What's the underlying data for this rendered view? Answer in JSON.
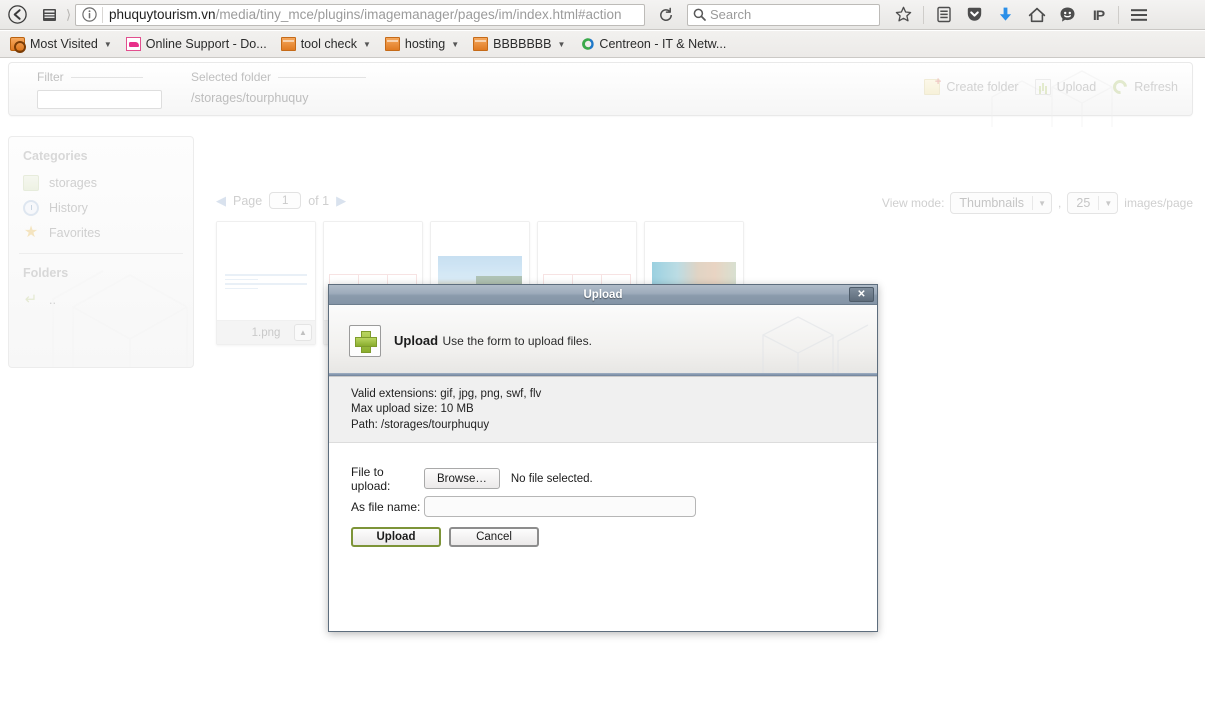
{
  "browser": {
    "url_host": "phuquytourism.vn",
    "url_path": "/media/tiny_mce/plugins/imagemanager/pages/im/index.html#action",
    "search_placeholder": "Search",
    "back_icon": "back-arrow-icon",
    "identity_icon": "info-circle-icon",
    "reload_icon": "reload-icon",
    "search_icon": "search-icon",
    "toolbar_icons": [
      {
        "name": "bookmark-star-icon",
        "glyph": "star"
      },
      {
        "name": "reading-list-icon",
        "glyph": "list"
      },
      {
        "name": "pocket-icon",
        "glyph": "shield"
      },
      {
        "name": "downloads-icon",
        "glyph": "down-arrow"
      },
      {
        "name": "home-icon",
        "glyph": "home"
      },
      {
        "name": "feedback-smiley-icon",
        "glyph": "smiley"
      },
      {
        "name": "ip-indicator-icon",
        "glyph": "IP"
      },
      {
        "name": "menu-hamburger-icon",
        "glyph": "hamburger"
      }
    ],
    "bookmarks": [
      {
        "label": "Most Visited",
        "icon": "most-visited-icon",
        "has_arrow": true
      },
      {
        "label": "Online Support - Do...",
        "icon": "support-icon",
        "has_arrow": false
      },
      {
        "label": "tool check",
        "icon": "folder-icon",
        "has_arrow": true
      },
      {
        "label": "hosting",
        "icon": "folder-icon",
        "has_arrow": true
      },
      {
        "label": "BBBBBBB",
        "icon": "folder-icon",
        "has_arrow": true
      },
      {
        "label": "Centreon - IT & Netw...",
        "icon": "centreon-icon",
        "has_arrow": false
      }
    ]
  },
  "top_panel": {
    "filter_legend": "Filter",
    "filter_value": "",
    "folder_legend": "Selected folder",
    "folder_value": "/storages/tourphuquy",
    "actions": [
      {
        "label": "Create folder",
        "icon": "new-folder-icon"
      },
      {
        "label": "Upload",
        "icon": "upload-icon"
      },
      {
        "label": "Refresh",
        "icon": "refresh-icon"
      }
    ]
  },
  "sidebar": {
    "categories_title": "Categories",
    "categories": [
      {
        "label": "storages",
        "icon": "drive-icon"
      },
      {
        "label": "History",
        "icon": "clock-icon"
      },
      {
        "label": "Favorites",
        "icon": "star-icon"
      }
    ],
    "folders_title": "Folders",
    "folders": [
      {
        "label": "..",
        "icon": "folder-up-icon"
      }
    ]
  },
  "pager": {
    "prev_icon": "prev-page-icon",
    "page_label": "Page",
    "page_value": "1",
    "of_label": "of 1",
    "next_icon": "next-page-icon"
  },
  "viewmode": {
    "label": "View mode:",
    "mode_value": "Thumbnails",
    "comma": ",",
    "count_value": "25",
    "suffix": "images/page"
  },
  "thumbnails": [
    {
      "caption": "1.png",
      "kind": "document-lines"
    },
    {
      "caption": "",
      "kind": "document-table"
    },
    {
      "caption": "",
      "kind": "photo-beach"
    },
    {
      "caption": "",
      "kind": "document-table"
    },
    {
      "caption": "",
      "kind": "photo-coral"
    }
  ],
  "dialog": {
    "title": "Upload",
    "close_icon": "close-icon",
    "header_icon": "green-plus-icon",
    "header_title": "Upload",
    "header_subtitle": "Use the form to upload files.",
    "info": {
      "extensions": "Valid extensions: gif, jpg, png, swf, flv",
      "max_size": "Max upload size: 10 MB",
      "path": "Path: /storages/tourphuquy"
    },
    "form": {
      "file_label": "File to upload:",
      "browse_button": "Browse…",
      "file_status": "No file selected.",
      "name_label": "As file name:",
      "name_value": "",
      "name_placeholder": ""
    },
    "buttons": {
      "upload": "Upload",
      "cancel": "Cancel"
    }
  },
  "colors": {
    "dialog_title_bar": "#94a3b4",
    "upload_button_border": "#7d9438",
    "download_icon": "#2a8fe8",
    "bookmark_folder": "#e07a22"
  }
}
